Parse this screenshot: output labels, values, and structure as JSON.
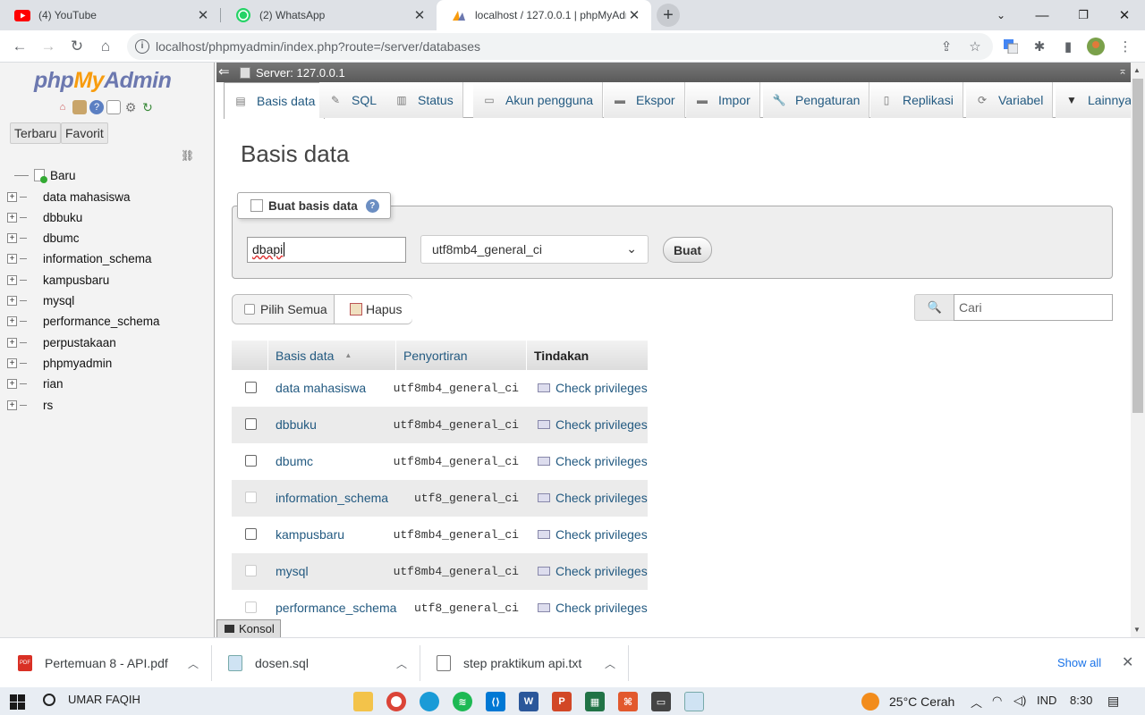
{
  "browser": {
    "tabs": [
      {
        "title": "(4) YouTube",
        "icon": "youtube-icon"
      },
      {
        "title": "(2) WhatsApp",
        "icon": "whatsapp-icon"
      },
      {
        "title": "localhost / 127.0.0.1 | phpMyAdmin",
        "icon": "phpmyadmin-icon"
      }
    ],
    "url": "localhost/phpmyadmin/index.php?route=/server/databases"
  },
  "sidebar": {
    "logo": {
      "php": "php",
      "my": "My",
      "admin": "Admin"
    },
    "buttons": {
      "recent": "Terbaru",
      "favorites": "Favorit"
    },
    "new_label": "Baru",
    "databases": [
      "data mahasiswa",
      "dbbuku",
      "dbumc",
      "information_schema",
      "kampusbaru",
      "mysql",
      "performance_schema",
      "perpustakaan",
      "phpmyadmin",
      "rian",
      "rs"
    ]
  },
  "server_bar": {
    "label": "Server: 127.0.0.1"
  },
  "main_tabs": [
    "Basis data",
    "SQL",
    "Status",
    "Akun pengguna",
    "Ekspor",
    "Impor",
    "Pengaturan",
    "Replikasi",
    "Variabel",
    "Lainnya"
  ],
  "page": {
    "title": "Basis data",
    "create": {
      "legend": "Buat basis data",
      "db_name_value": "dbapi",
      "collation": "utf8mb4_general_ci",
      "button": "Buat"
    },
    "select_all": "Pilih Semua",
    "delete": "Hapus",
    "search_placeholder": "Cari"
  },
  "table": {
    "headers": [
      "Basis data",
      "Penyortiran",
      "Tindakan"
    ],
    "sort_indicator": "▲",
    "rows": [
      {
        "name": "data mahasiswa",
        "collation": "utf8mb4_general_ci",
        "action": "Check privileges",
        "disabled": false
      },
      {
        "name": "dbbuku",
        "collation": "utf8mb4_general_ci",
        "action": "Check privileges",
        "disabled": false
      },
      {
        "name": "dbumc",
        "collation": "utf8mb4_general_ci",
        "action": "Check privileges",
        "disabled": false
      },
      {
        "name": "information_schema",
        "collation": "utf8_general_ci",
        "action": "Check privileges",
        "disabled": true
      },
      {
        "name": "kampusbaru",
        "collation": "utf8mb4_general_ci",
        "action": "Check privileges",
        "disabled": false
      },
      {
        "name": "mysql",
        "collation": "utf8mb4_general_ci",
        "action": "Check privileges",
        "disabled": true
      },
      {
        "name": "performance_schema",
        "collation": "utf8_general_ci",
        "action": "Check privileges",
        "disabled": true
      }
    ]
  },
  "console": "Konsol",
  "downloads": {
    "items": [
      "Pertemuan 8 - API.pdf",
      "dosen.sql",
      "step praktikum api.txt"
    ],
    "show_all": "Show all"
  },
  "taskbar": {
    "search_text": "UMAR FAQIH",
    "weather": "25°C  Cerah",
    "lang": "IND",
    "time": "8:30"
  },
  "colors": {
    "link": "#235a81",
    "accent": "#1a73e8",
    "logo_blue": "#6c78af",
    "logo_orange": "#f89c0e"
  }
}
